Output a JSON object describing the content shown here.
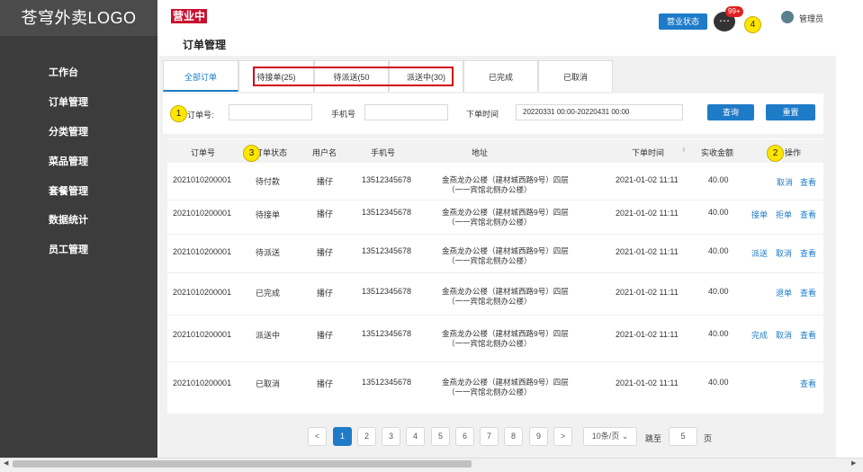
{
  "logo": "苍穹外卖LOGO",
  "sidebar": {
    "items": [
      "工作台",
      "订单管理",
      "分类管理",
      "菜品管理",
      "套餐管理",
      "数据统计",
      "员工管理"
    ]
  },
  "header": {
    "shop_status": "营业中",
    "page_title": "订单管理",
    "business_status_button": "营业状态",
    "message_badge": "99+",
    "admin_name": "管理员"
  },
  "markers": [
    "1",
    "2",
    "3",
    "4"
  ],
  "tabs": [
    "全部订单",
    "待接单(25)",
    "待派送(50",
    "派送中(30)",
    "已完成",
    "已取消"
  ],
  "filter": {
    "order_no_label": "订单号:",
    "order_no_value": "",
    "phone_label": "手机号",
    "phone_value": "",
    "time_label": "下单时间",
    "time_value": "20220331 00:00-20220431 00:00",
    "query_button": "查询",
    "reset_button": "重置"
  },
  "table": {
    "headers": [
      "订单号",
      "订单状态",
      "用户名",
      "手机号",
      "地址",
      "下单时间",
      "实收金额",
      "操作"
    ],
    "sort_icon": "sort-icon",
    "rows": [
      {
        "order_no": "2021010200001",
        "status": "待付款",
        "user": "播仔",
        "phone": "13512345678",
        "addr1": "金燕龙办公楼（建材城西路9号）四层",
        "addr2": "（一一宾馆北侧办公楼）",
        "time": "2021-01-02 11:11",
        "amount": "40.00",
        "actions": [
          "取消",
          "查看"
        ]
      },
      {
        "order_no": "2021010200001",
        "status": "待接单",
        "user": "播仔",
        "phone": "13512345678",
        "addr1": "金燕龙办公楼（建材城西路9号）四层",
        "addr2": "（一一宾馆北侧办公楼）",
        "time": "2021-01-02 11:11",
        "amount": "40.00",
        "actions": [
          "接单",
          "拒单",
          "查看"
        ]
      },
      {
        "order_no": "2021010200001",
        "status": "待派送",
        "user": "播仔",
        "phone": "13512345678",
        "addr1": "金燕龙办公楼（建材城西路9号）四层",
        "addr2": "（一一宾馆北侧办公楼）",
        "time": "2021-01-02 11:11",
        "amount": "40.00",
        "actions": [
          "派送",
          "取消",
          "查看"
        ]
      },
      {
        "order_no": "2021010200001",
        "status": "已完成",
        "user": "播仔",
        "phone": "13512345678",
        "addr1": "金燕龙办公楼（建材城西路9号）四层",
        "addr2": "（一一宾馆北侧办公楼）",
        "time": "2021-01-02 11:11",
        "amount": "40.00",
        "actions": [
          "退单",
          "查看"
        ]
      },
      {
        "order_no": "2021010200001",
        "status": "派送中",
        "user": "播仔",
        "phone": "13512345678",
        "addr1": "金燕龙办公楼（建材城西路9号）四层",
        "addr2": "（一一宾馆北侧办公楼）",
        "time": "2021-01-02 11:11",
        "amount": "40.00",
        "actions": [
          "完成",
          "取消",
          "查看"
        ]
      },
      {
        "order_no": "2021010200001",
        "status": "已取消",
        "user": "播仔",
        "phone": "13512345678",
        "addr1": "金燕龙办公楼（建材城西路9号）四层",
        "addr2": "（一一宾馆北侧办公楼）",
        "time": "2021-01-02 11:11",
        "amount": "40.00",
        "actions": [
          "查看"
        ]
      }
    ]
  },
  "pagination": {
    "prev": "<",
    "pages": [
      "1",
      "2",
      "3",
      "4",
      "5",
      "6",
      "7",
      "8",
      "9"
    ],
    "current": "1",
    "next": ">",
    "page_size": "10条/页",
    "goto_label": "跳至",
    "goto_value": "5",
    "page_suffix": "页"
  },
  "colors": {
    "accent": "#1e7bc8",
    "sidebar": "#3c3c3c",
    "status": "#c8102e",
    "highlight": "#d0021b",
    "marker": "#ffe600"
  }
}
